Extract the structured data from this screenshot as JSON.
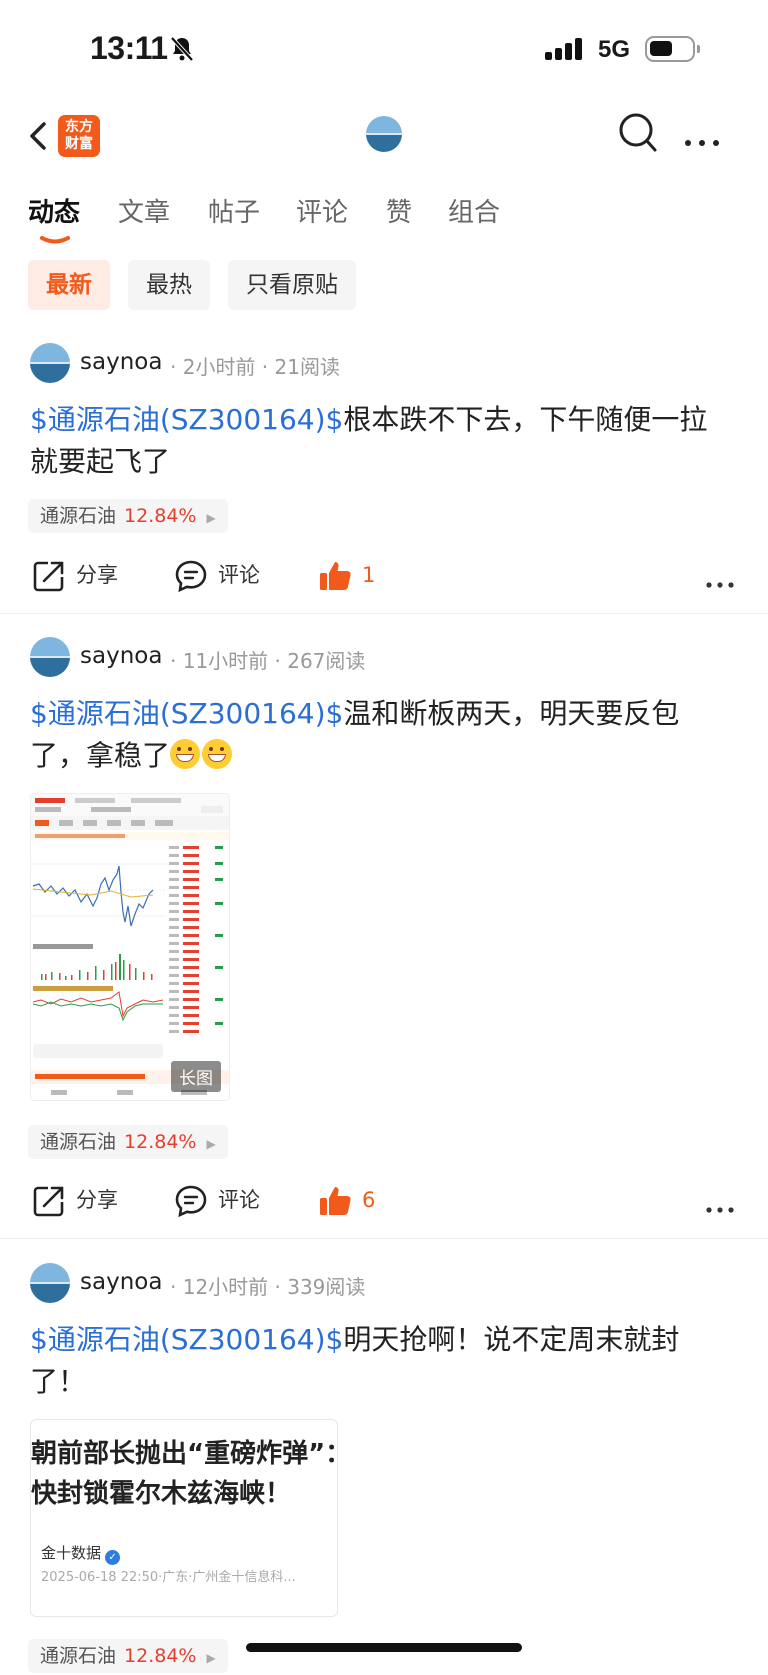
{
  "status_bar": {
    "time": "13:11",
    "network": "5G"
  },
  "top_bar": {
    "logo_line1": "东方",
    "logo_line2": "财富"
  },
  "tabs": [
    {
      "label": "动态"
    },
    {
      "label": "文章"
    },
    {
      "label": "帖子"
    },
    {
      "label": "评论"
    },
    {
      "label": "赞"
    },
    {
      "label": "组合"
    }
  ],
  "filters": [
    {
      "label": "最新"
    },
    {
      "label": "最热"
    },
    {
      "label": "只看原贴"
    }
  ],
  "posts": [
    {
      "username": "saynoa",
      "meta": "· 2小时前 · 21阅读",
      "tag": "$通源石油(SZ300164)$",
      "text": "根本跌不下去，下午随便一拉就要起飞了",
      "stock_name": "通源石油",
      "stock_change": "12.84%",
      "share": "分享",
      "comment": "评论",
      "likes": "1"
    },
    {
      "username": "saynoa",
      "meta": "· 11小时前 · 267阅读",
      "tag": "$通源石油(SZ300164)$",
      "text": "温和断板两天，明天要反包了，拿稳了",
      "image_badge": "长图",
      "stock_name": "通源石油",
      "stock_change": "12.84%",
      "share": "分享",
      "comment": "评论",
      "likes": "6"
    },
    {
      "username": "saynoa",
      "meta": "· 12小时前 · 339阅读",
      "tag": "$通源石油(SZ300164)$",
      "text": "明天抢啊！说不定周末就封了！",
      "news_headline_1": "朝前部长抛出“重磅炸弹”：",
      "news_headline_2": "快封锁霍尔木兹海峡！",
      "news_source": "金十数据",
      "news_date": "2025-06-18 22:50·广东·广州金十信息科...",
      "stock_name": "通源石油",
      "stock_change": "12.84%"
    }
  ],
  "colors": {
    "accent": "#f25a1c",
    "link": "#2a6fd6",
    "up": "#e63e2c"
  }
}
